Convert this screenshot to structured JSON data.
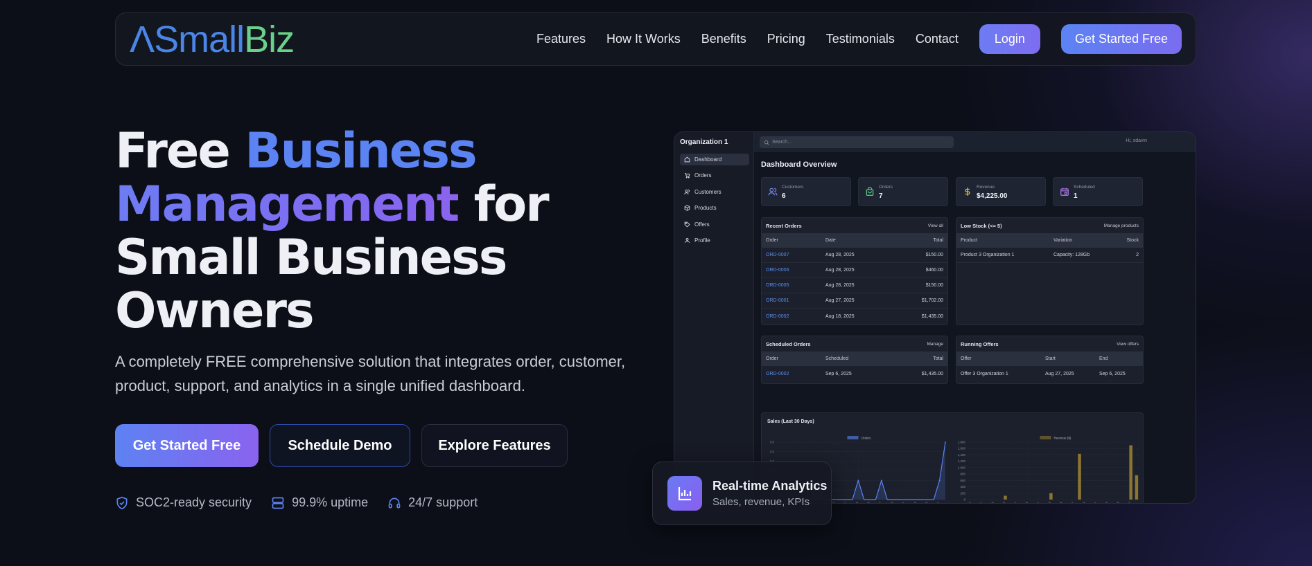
{
  "brand": {
    "part_a": "ΛSmall",
    "part_b": "Biz",
    "color_a": "#4a86e8",
    "color_b": "#6bd18a"
  },
  "nav": {
    "links": [
      "Features",
      "How It Works",
      "Benefits",
      "Pricing",
      "Testimonials",
      "Contact"
    ],
    "login": "Login",
    "get_started": "Get Started Free"
  },
  "hero": {
    "title_free": "Free ",
    "title_business": "Business",
    "title_management": "Management",
    "title_for": " for",
    "title_line3": "Small Business",
    "title_line4": "Owners",
    "subtitle": "A completely FREE comprehensive solution that integrates order, customer, product, support, and analytics in a single unified dashboard.",
    "btn_primary": "Get Started Free",
    "btn_demo": "Schedule Demo",
    "btn_features": "Explore Features",
    "trust": [
      {
        "icon": "shield-check-icon",
        "label": "SOC2-ready security"
      },
      {
        "icon": "server-icon",
        "label": "99.9% uptime"
      },
      {
        "icon": "headset-icon",
        "label": "24/7 support"
      }
    ]
  },
  "dashboard": {
    "org": "Organization 1",
    "search_placeholder": "Search...",
    "greeting": "Hi, sdavin",
    "title": "Dashboard Overview",
    "sidebar": [
      "Dashboard",
      "Orders",
      "Customers",
      "Products",
      "Offers",
      "Profile"
    ],
    "kpis": [
      {
        "label": "Customers",
        "value": "6",
        "icon": "users-icon",
        "color": "#7b8ff5"
      },
      {
        "label": "Orders",
        "value": "7",
        "icon": "bag-icon",
        "color": "#5fd08a"
      },
      {
        "label": "Revenue",
        "value": "$4,225.00",
        "icon": "dollar-icon",
        "color": "#e2b54a"
      },
      {
        "label": "Scheduled",
        "value": "1",
        "icon": "calendar-icon",
        "color": "#b07cf0"
      }
    ],
    "recent_orders": {
      "title": "Recent Orders",
      "link": "View all",
      "headers": [
        "Order",
        "Date",
        "Total"
      ],
      "rows": [
        [
          "ORD-0007",
          "Aug 28, 2025",
          "$150.00"
        ],
        [
          "ORD-0006",
          "Aug 28, 2025",
          "$460.00"
        ],
        [
          "ORD-0005",
          "Aug 28, 2025",
          "$150.00"
        ],
        [
          "ORD-0001",
          "Aug 27, 2025",
          "$1,702.00"
        ],
        [
          "ORD-0002",
          "Aug 18, 2025",
          "$1,435.00"
        ]
      ]
    },
    "low_stock": {
      "title": "Low Stock (<= 5)",
      "link": "Manage products",
      "headers": [
        "Product",
        "Variation",
        "Stock"
      ],
      "rows": [
        [
          "Product 3 Organization 1",
          "Capacity: 128Gb",
          "2"
        ]
      ]
    },
    "scheduled_orders": {
      "title": "Scheduled Orders",
      "link": "Manage",
      "headers": [
        "Order",
        "Scheduled",
        "Total"
      ],
      "rows": [
        [
          "ORD-0002",
          "Sep 6, 2025",
          "$1,435.00"
        ]
      ]
    },
    "running_offers": {
      "title": "Running Offers",
      "link": "View offers",
      "headers": [
        "Offer",
        "Start",
        "End"
      ],
      "rows": [
        [
          "Offer 3 Organization 1",
          "Aug 27, 2025",
          "Sep 6, 2025"
        ]
      ]
    },
    "sales_title": "Sales (Last 30 Days)"
  },
  "chart_data": [
    {
      "type": "area",
      "series": [
        {
          "name": "Orders",
          "color": "#5b83f3",
          "x": [
            "Jul 30",
            "Jul 31",
            "Aug 1",
            "Aug 2",
            "Aug 3",
            "Aug 4",
            "Aug 5",
            "Aug 6",
            "Aug 7",
            "Aug 8",
            "Aug 9",
            "Aug 10",
            "Aug 11",
            "Aug 12",
            "Aug 13",
            "Aug 14",
            "Aug 15",
            "Aug 16",
            "Aug 17",
            "Aug 18",
            "Aug 19",
            "Aug 20",
            "Aug 21",
            "Aug 22",
            "Aug 23",
            "Aug 24",
            "Aug 25",
            "Aug 26",
            "Aug 27",
            "Aug 28"
          ],
          "values": [
            0,
            0,
            0,
            0,
            0,
            0,
            0,
            1,
            0,
            0,
            0,
            0,
            0,
            0,
            1,
            0,
            0,
            0,
            1,
            0,
            0,
            0,
            0,
            0,
            0,
            0,
            0,
            0,
            1,
            3
          ]
        }
      ],
      "yticks": [
        "3.0",
        "2.5",
        "2.0",
        "1.5",
        "1.0",
        "0.5",
        "0"
      ],
      "xticks": [
        "Aug 1",
        "Aug 3",
        "Aug 5",
        "Aug 7",
        "Aug 9",
        "Aug 11",
        "Aug 13",
        "Aug 15",
        "Aug 17",
        "Aug 19",
        "Aug 21",
        "Aug 23",
        "Aug 25",
        "Aug 27"
      ],
      "ylim": [
        0,
        3
      ]
    },
    {
      "type": "bar",
      "series": [
        {
          "name": "Revenue ($)",
          "color": "#8c7431",
          "x": [
            "Jul 30",
            "Jul 31",
            "Aug 1",
            "Aug 2",
            "Aug 3",
            "Aug 4",
            "Aug 5",
            "Aug 6",
            "Aug 7",
            "Aug 8",
            "Aug 9",
            "Aug 10",
            "Aug 11",
            "Aug 12",
            "Aug 13",
            "Aug 14",
            "Aug 15",
            "Aug 16",
            "Aug 17",
            "Aug 18",
            "Aug 19",
            "Aug 20",
            "Aug 21",
            "Aug 22",
            "Aug 23",
            "Aug 24",
            "Aug 25",
            "Aug 26",
            "Aug 27",
            "Aug 28"
          ],
          "values": [
            0,
            0,
            0,
            0,
            0,
            0,
            120,
            0,
            0,
            0,
            0,
            0,
            0,
            0,
            200,
            0,
            0,
            0,
            0,
            1435,
            0,
            0,
            0,
            0,
            0,
            0,
            0,
            0,
            1702,
            760
          ]
        }
      ],
      "yticks": [
        "1,800",
        "1,600",
        "1,400",
        "1,200",
        "1,000",
        "800",
        "600",
        "400",
        "200",
        "0"
      ],
      "xticks": [
        "Jul 30",
        "Aug 1",
        "Aug 3",
        "Aug 5",
        "Aug 7",
        "Aug 9",
        "Aug 11",
        "Aug 13",
        "Aug 15",
        "Aug 17",
        "Aug 19",
        "Aug 21",
        "Aug 23",
        "Aug 25",
        "Aug 27"
      ],
      "ylim": [
        0,
        1800
      ]
    }
  ],
  "floating_card": {
    "title": "Real-time Analytics",
    "subtitle": "Sales, revenue, KPIs"
  }
}
